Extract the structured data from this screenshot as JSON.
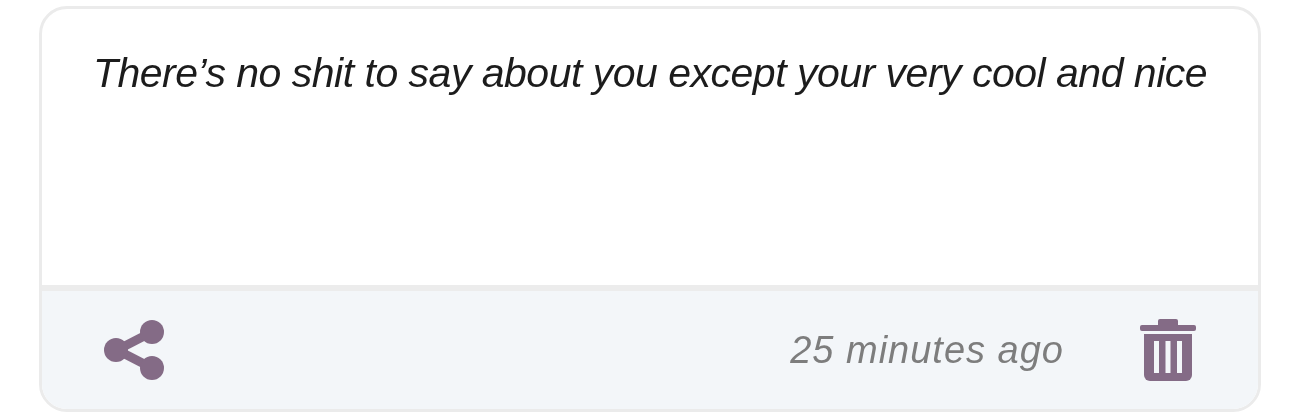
{
  "message": {
    "text": "There’s no shit to say about you except your very cool and nice"
  },
  "footer": {
    "time": "25 minutes ago"
  }
}
